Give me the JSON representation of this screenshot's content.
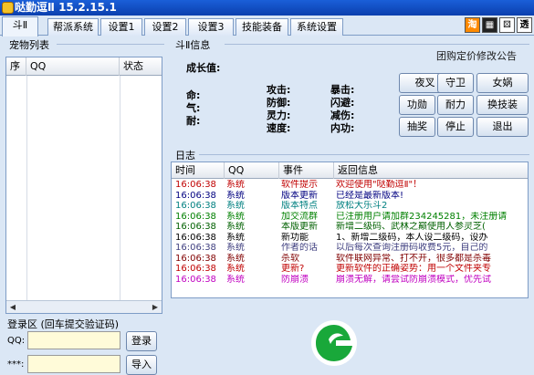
{
  "window": {
    "title": "哒勤逗Ⅱ  15.2.15.1"
  },
  "tabs": [
    "斗Ⅱ",
    "帮派系统",
    "设置1",
    "设置2",
    "设置3",
    "技能装备",
    "系统设置"
  ],
  "toolbar_icons": [
    "tao-icon",
    "film-icon",
    "dice-icon",
    "tou-icon"
  ],
  "toolbar_icon_text": {
    "tao": "淘",
    "tou": "透"
  },
  "pet_panel": {
    "label": "宠物列表",
    "columns": [
      "序",
      "QQ",
      "状态"
    ]
  },
  "login": {
    "label": "登录区 (回车提交验证码)",
    "qq_label": "QQ:",
    "pw_label": "***:",
    "login_button": "登录",
    "import_button": "导入"
  },
  "info": {
    "label": "斗Ⅱ信息",
    "growth_label": "成长值:",
    "group_link": "团购定价修改公告",
    "stats_left": [
      "命:",
      "气:",
      "耐:"
    ],
    "stats_mid": [
      "攻击:",
      "防御:",
      "灵力:",
      "速度:"
    ],
    "stats_right": [
      "暴击:",
      "闪避:",
      "减伤:",
      "内功:"
    ],
    "buttons": [
      "夜叉",
      "守卫",
      "女娲",
      "功勋",
      "耐力",
      "换技装",
      "抽奖",
      "停止",
      "退出"
    ]
  },
  "log": {
    "label": "日志",
    "columns": [
      "时间",
      "QQ",
      "事件",
      "返回信息"
    ],
    "rows": [
      {
        "time": "16:06:38",
        "qq": "系统",
        "event": "软件提示",
        "msg": "欢迎使用\"哒勤逗Ⅱ\"！",
        "color": "#c00000"
      },
      {
        "time": "16:06:38",
        "qq": "系统",
        "event": "版本更新",
        "msg": "已经是最新版本!",
        "color": "#000080"
      },
      {
        "time": "16:06:38",
        "qq": "系统",
        "event": "版本特点",
        "msg": "放松大乐斗2",
        "color": "#008080"
      },
      {
        "time": "16:06:38",
        "qq": "系统",
        "event": "加交流群",
        "msg": "已注册用户请加群234245281，未注册请",
        "color": "#008000"
      },
      {
        "time": "16:06:38",
        "qq": "系统",
        "event": "本版更新",
        "msg": "新增二级码、武林之巅使用人参灵芝(",
        "color": "#006000"
      },
      {
        "time": "16:06:38",
        "qq": "系统",
        "event": "新功能",
        "msg": "1、新增二级码，本人设二级码，设办",
        "color": "#000000"
      },
      {
        "time": "16:06:38",
        "qq": "系统",
        "event": "作者的话",
        "msg": "以后每次查询注册码收费5元，自己的",
        "color": "#404080"
      },
      {
        "time": "16:06:38",
        "qq": "系统",
        "event": "杀软",
        "msg": "软件联网异常、打不开，很多都是杀毒",
        "color": "#800000"
      },
      {
        "time": "16:06:38",
        "qq": "系统",
        "event": "更新?",
        "msg": "更新软件的正确姿势：用一个文件夹专",
        "color": "#c00000"
      },
      {
        "time": "16:06:38",
        "qq": "系统",
        "event": "防崩溃",
        "msg": "崩溃无解，请尝试防崩溃模式，优先试",
        "color": "#c000c0"
      }
    ]
  },
  "colors": {
    "accent": "#1a5fd8",
    "panel": "#dbe7f5",
    "input_bg": "#fffbd9"
  }
}
